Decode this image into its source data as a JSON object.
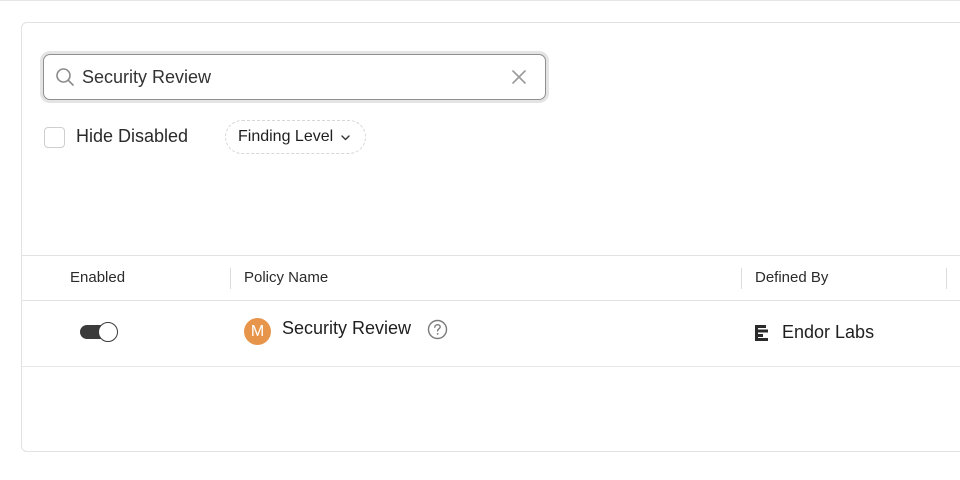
{
  "search": {
    "value": "Security Review",
    "icon": "search-icon",
    "clear_icon": "close-icon"
  },
  "filters": {
    "hide_disabled": {
      "label": "Hide Disabled",
      "checked": false
    },
    "finding_level": {
      "label": "Finding Level",
      "icon": "chevron-down-icon"
    }
  },
  "table": {
    "columns": [
      "Enabled",
      "Policy Name",
      "Defined By"
    ],
    "rows": [
      {
        "enabled": true,
        "avatar_letter": "M",
        "policy_name": "Security Review",
        "defined_by": "Endor Labs"
      }
    ]
  },
  "colors": {
    "avatar": "#e8954c",
    "toggle_on": "#3b3b3b"
  }
}
